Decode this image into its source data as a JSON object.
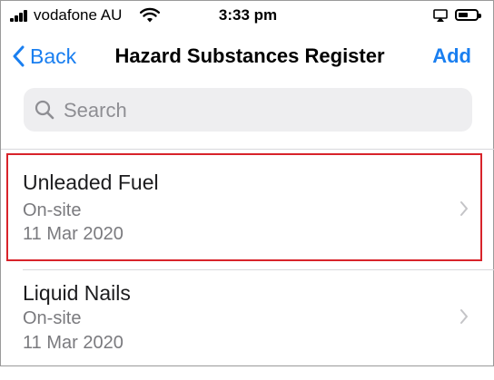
{
  "status_bar": {
    "carrier": "vodafone AU",
    "time": "3:33 pm",
    "battery_level": 0.4
  },
  "nav": {
    "back_label": "Back",
    "title": "Hazard Substances Register",
    "add_label": "Add"
  },
  "search": {
    "placeholder": "Search"
  },
  "items": [
    {
      "name": "Unleaded Fuel",
      "location": "On-site",
      "date": "11 Mar 2020"
    },
    {
      "name": "Liquid Nails",
      "location": "On-site",
      "date": "11 Mar 2020"
    }
  ],
  "colors": {
    "accent": "#1a7ff0",
    "highlight": "#d8232a"
  }
}
